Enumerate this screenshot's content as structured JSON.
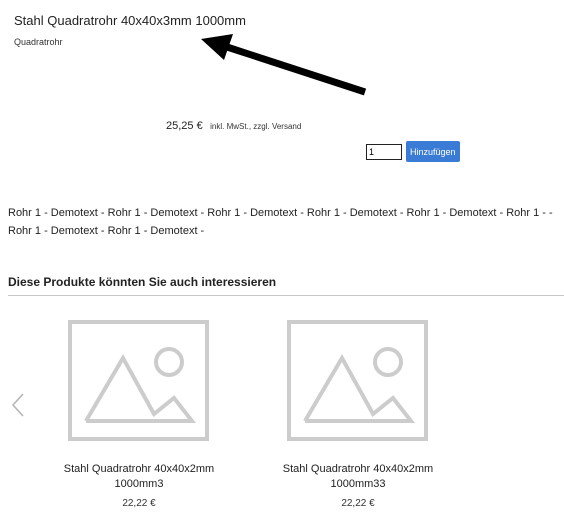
{
  "product": {
    "title": "Stahl Quadratrohr 40x40x3mm 1000mm",
    "category": "Quadratrohr",
    "price": "25,25 €",
    "price_note": "inkl. MwSt., zzgl. Versand",
    "quantity": "1",
    "add_button_label": "Hinzufügen",
    "description": "Rohr 1 - Demotext - Rohr 1 - Demotext - Rohr 1 - Demotext - Rohr 1 - Demotext - Rohr 1 - Demotext - Rohr 1 - - Rohr 1 - Demotext - Rohr 1 - Demotext -"
  },
  "related": {
    "heading": "Diese Produkte könnten Sie auch interessieren",
    "prev_icon": "chevron-left-icon",
    "items": [
      {
        "title": "Stahl Quadratrohr 40x40x2mm 1000mm3",
        "price": "22,22 €",
        "icon": "image-placeholder-icon"
      },
      {
        "title": "Stahl Quadratrohr 40x40x2mm 1000mm33",
        "price": "22,22 €",
        "icon": "image-placeholder-icon"
      }
    ]
  },
  "colors": {
    "button": "#3a7bd5",
    "placeholder": "#cccccc",
    "annotation_arrow": "#000000"
  }
}
